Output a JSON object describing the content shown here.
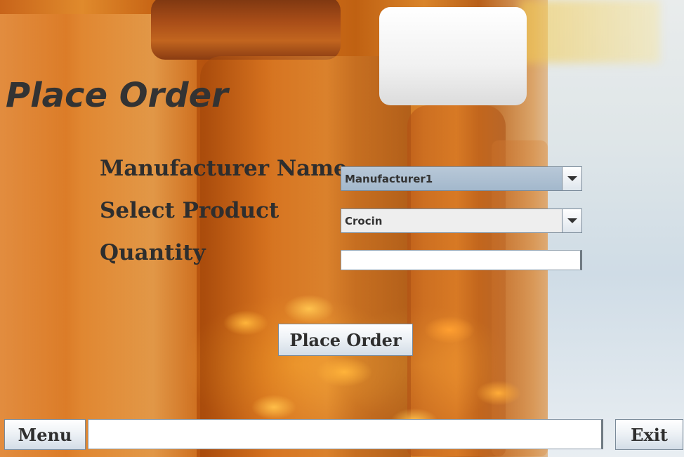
{
  "window": {
    "title": "Place Order"
  },
  "form": {
    "manufacturer_label": "Manufacturer Name",
    "manufacturer_value": "Manufacturer1",
    "product_label": "Select Product",
    "product_value": "Crocin",
    "quantity_label": "Quantity",
    "quantity_value": ""
  },
  "actions": {
    "place_order_label": "Place Order",
    "menu_label": "Menu",
    "exit_label": "Exit"
  },
  "status": {
    "value": ""
  },
  "icons": {
    "dropdown_arrow": "chevron-down-icon"
  }
}
